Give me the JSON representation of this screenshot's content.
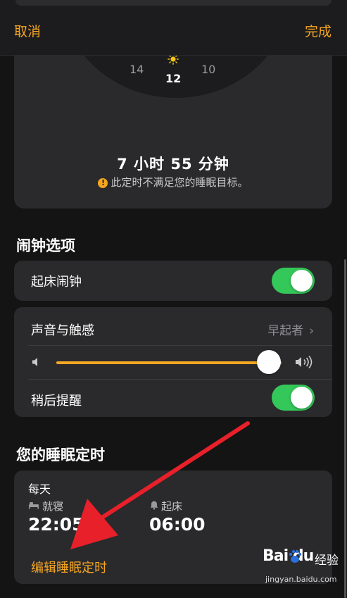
{
  "nav": {
    "cancel": "取消",
    "done": "完成"
  },
  "clock": {
    "tick_left": "14",
    "tick_center": "12",
    "tick_right": "10",
    "sun_icon": "sun-icon",
    "duration": "7 小时 55 分钟",
    "warning": "此定时不满足您的睡眠目标。"
  },
  "alarm_options": {
    "title": "闹钟选项",
    "wake_alarm": {
      "label": "起床闹钟",
      "on": true
    },
    "sound": {
      "label": "声音与触感",
      "value": "早起者"
    },
    "volume": {
      "level": 0.95
    },
    "snooze": {
      "label": "稍后提醒",
      "on": true
    }
  },
  "schedule": {
    "title": "您的睡眠定时",
    "day": "每天",
    "bedtime_label": "就寝",
    "bedtime": "22:05",
    "wake_label": "起床",
    "wake": "06:00",
    "edit": "编辑睡眠定时"
  },
  "watermark": {
    "logo": "Bai  du",
    "text": "经验",
    "url": "jingyan.baidu.com"
  },
  "colors": {
    "accent": "#f5a623",
    "toggle_on": "#34c759",
    "arrow": "#e8202a",
    "card": "#2a2a2c"
  }
}
